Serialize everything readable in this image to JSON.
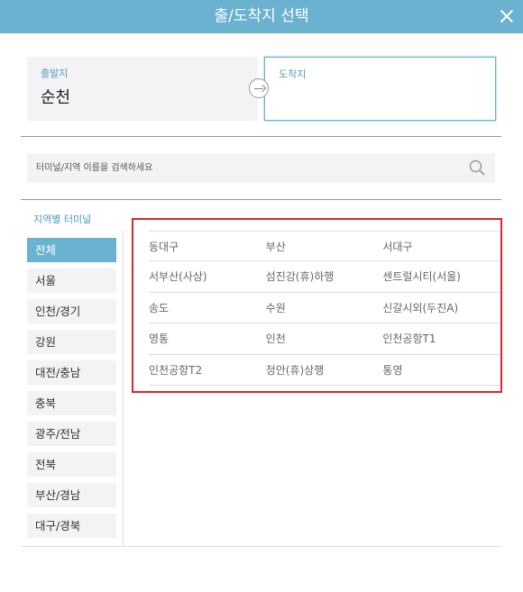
{
  "header": {
    "title": "출/도착지 선택"
  },
  "departure": {
    "label": "출발지",
    "value": "순천"
  },
  "arrival": {
    "label": "도착지",
    "value": ""
  },
  "search": {
    "placeholder": "터미널/지역 이름을 검색하세요",
    "value": ""
  },
  "regions": {
    "title": "지역별 터미널",
    "items": [
      "전체",
      "서울",
      "인천/경기",
      "강원",
      "대전/충남",
      "충북",
      "광주/전남",
      "전북",
      "부산/경남",
      "대구/경북"
    ],
    "active_index": 0
  },
  "terminals": [
    [
      "동대구",
      "부산",
      "서대구"
    ],
    [
      "서부산(사상)",
      "섬진강(휴)하행",
      "센트럴시티(서울)"
    ],
    [
      "송도",
      "수원",
      "신갈시외(두진A)"
    ],
    [
      "영통",
      "인천",
      "인천공항T1"
    ],
    [
      "인천공항T2",
      "정안(휴)상행",
      "통영"
    ]
  ],
  "colors": {
    "header_bg": "#6ab2d0",
    "highlight_border": "#d9262a",
    "label_blue": "#5a9bb8"
  },
  "icons": {
    "close": "close-icon",
    "swap": "arrow-right-icon",
    "search": "search-icon"
  }
}
